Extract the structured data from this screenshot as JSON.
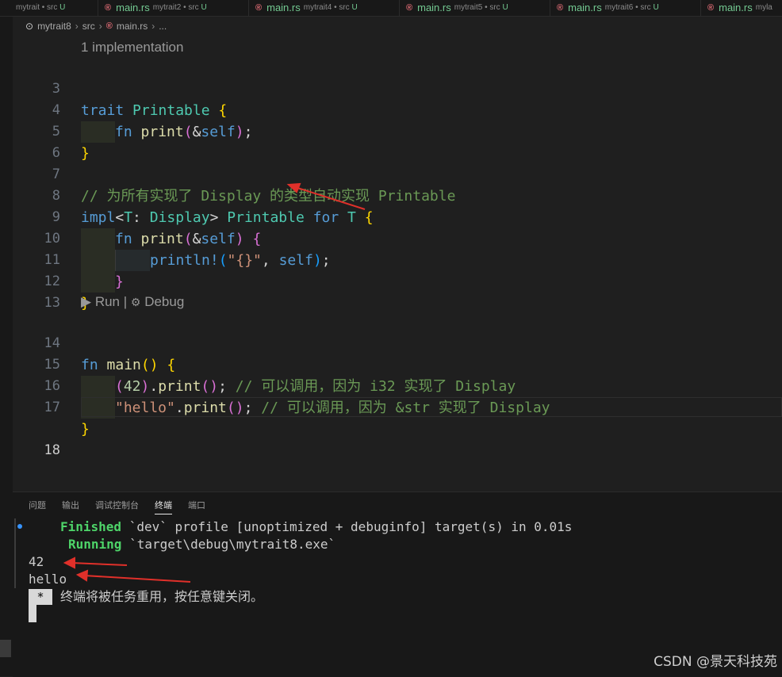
{
  "tabs": [
    {
      "name": "",
      "desc": "mytrait • src",
      "status": "U"
    },
    {
      "name": "main.rs",
      "desc": "mytrait2 • src",
      "status": "U"
    },
    {
      "name": "main.rs",
      "desc": "mytrait4 • src",
      "status": "U"
    },
    {
      "name": "main.rs",
      "desc": "mytrait5 • src",
      "status": "U"
    },
    {
      "name": "main.rs",
      "desc": "mytrait6 • src",
      "status": "U"
    },
    {
      "name": "main.rs",
      "desc": "myla",
      "status": ""
    }
  ],
  "breadcrumb": {
    "project": "mytrait8",
    "folder": "src",
    "file": "main.rs",
    "more": "..."
  },
  "editor": {
    "codelens_impl": "1 implementation",
    "codelens_run": "Run",
    "codelens_sep": "|",
    "codelens_debug": "Debug",
    "line_numbers": [
      "3",
      "4",
      "5",
      "6",
      "7",
      "8",
      "9",
      "10",
      "11",
      "12",
      "13",
      "14",
      "15",
      "16",
      "17",
      "18"
    ],
    "comment_line7": "// 为所有实现了 Display 的类型自动实现 Printable",
    "comment_line15": "// 可以调用，因为 i32 实现了 Display",
    "comment_line16": "// 可以调用，因为 &str 实现了 Display"
  },
  "panel": {
    "tabs": [
      "问题",
      "输出",
      "调试控制台",
      "终端",
      "端口"
    ],
    "active_tab": "终端",
    "finished_label": "Finished",
    "finished_text": " `dev` profile [unoptimized + debuginfo] target(s) in 0.01s",
    "running_label": "Running",
    "running_text": " `target\\debug\\mytrait8.exe`",
    "output_1": "42",
    "output_2": "hello",
    "reuse_star": "*",
    "reuse_msg": "终端将被任务重用，按任意键关闭。"
  },
  "watermark": "CSDN @景天科技苑",
  "colors": {
    "background": "#1f1f1f",
    "keyword": "#569cd6",
    "type": "#4ec9b0",
    "function": "#dcdcaa",
    "comment": "#6a9955",
    "string": "#ce9178",
    "terminal_green": "#4ed469",
    "arrow": "#e0302a"
  }
}
